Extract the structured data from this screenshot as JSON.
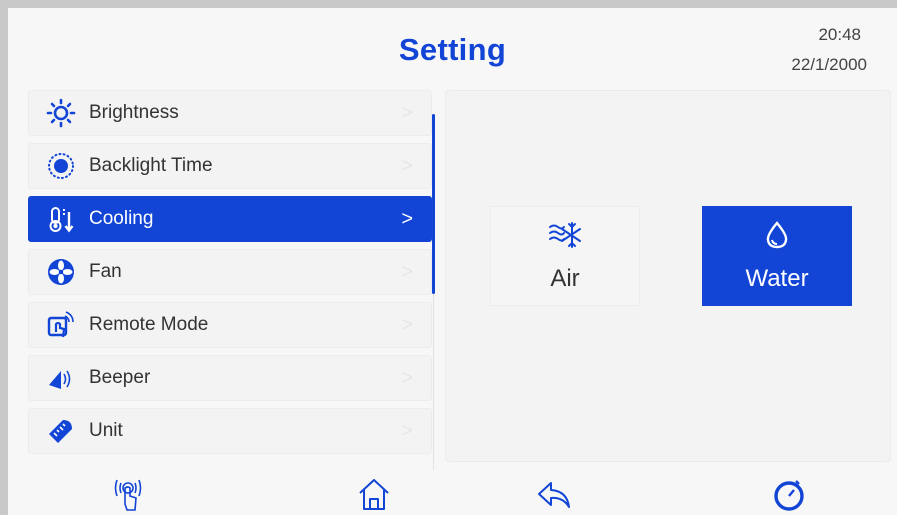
{
  "header": {
    "title": "Setting",
    "time": "20:48",
    "date": "22/1/2000"
  },
  "menu": {
    "items": [
      {
        "label": "Brightness",
        "icon": "brightness-icon"
      },
      {
        "label": "Backlight Time",
        "icon": "backlight-icon"
      },
      {
        "label": "Cooling",
        "icon": "thermometer-icon",
        "active": true
      },
      {
        "label": "Fan",
        "icon": "fan-icon"
      },
      {
        "label": "Remote Mode",
        "icon": "remote-touch-icon"
      },
      {
        "label": "Beeper",
        "icon": "speaker-icon"
      },
      {
        "label": "Unit",
        "icon": "ruler-icon"
      }
    ],
    "chevron": ">"
  },
  "cooling": {
    "options": [
      {
        "label": "Air",
        "icon": "wind-snowflake-icon",
        "selected": false
      },
      {
        "label": "Water",
        "icon": "water-drop-icon",
        "selected": true
      }
    ]
  },
  "nav": [
    {
      "icon": "touch-icon"
    },
    {
      "icon": "home-icon"
    },
    {
      "icon": "back-icon"
    },
    {
      "icon": "timer-icon"
    }
  ],
  "colors": {
    "accent": "#1244d6",
    "background": "#f7f7f7",
    "text": "#333333"
  }
}
